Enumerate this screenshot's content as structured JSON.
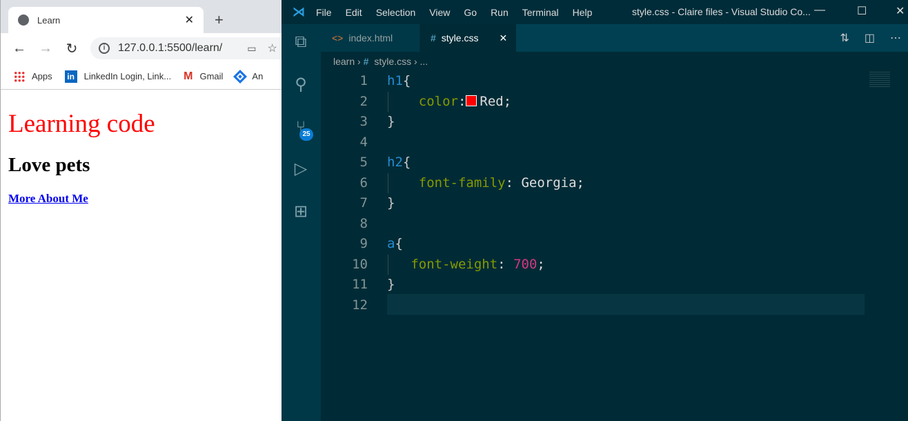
{
  "browser": {
    "tab_title": "Learn",
    "url": "127.0.0.1:5500/learn/",
    "bookmarks": [
      "Apps",
      "LinkedIn Login, Link...",
      "Gmail",
      "An"
    ],
    "page": {
      "h1": "Learning code",
      "h2": "Love pets",
      "link": "More About Me"
    }
  },
  "vscode": {
    "menu": [
      "File",
      "Edit",
      "Selection",
      "View",
      "Go",
      "Run",
      "Terminal",
      "Help"
    ],
    "window_title": "style.css - Claire files - Visual Studio Co...",
    "tabs": [
      {
        "label": "index.html"
      },
      {
        "label": "style.css"
      }
    ],
    "breadcrumb": {
      "folder": "learn",
      "file": "style.css",
      "more": "..."
    },
    "scm_badge": "25",
    "swatch_color": "#ff0000",
    "lines": [
      {
        "n": "1",
        "tokens": [
          [
            "sel",
            "h1"
          ],
          [
            "brace",
            "{"
          ]
        ]
      },
      {
        "n": "2",
        "indent": "    ",
        "tokens": [
          [
            "prop",
            "color"
          ],
          [
            "val",
            ":"
          ],
          [
            "swatch",
            ""
          ],
          [
            "val",
            "Red;"
          ]
        ]
      },
      {
        "n": "3",
        "tokens": [
          [
            "brace",
            "}"
          ]
        ]
      },
      {
        "n": "4",
        "tokens": []
      },
      {
        "n": "5",
        "tokens": [
          [
            "sel",
            "h2"
          ],
          [
            "brace",
            "{"
          ]
        ]
      },
      {
        "n": "6",
        "indent": "    ",
        "tokens": [
          [
            "prop",
            "font-family"
          ],
          [
            "val",
            ": Georgia;"
          ]
        ]
      },
      {
        "n": "7",
        "tokens": [
          [
            "brace",
            "}"
          ]
        ]
      },
      {
        "n": "8",
        "tokens": []
      },
      {
        "n": "9",
        "tokens": [
          [
            "sel",
            "a"
          ],
          [
            "brace",
            "{"
          ]
        ]
      },
      {
        "n": "10",
        "indent": "   ",
        "tokens": [
          [
            "prop",
            "font-weight"
          ],
          [
            "val",
            ": "
          ],
          [
            "num",
            "700"
          ],
          [
            "val",
            ";"
          ]
        ]
      },
      {
        "n": "11",
        "tokens": [
          [
            "brace",
            "}"
          ]
        ]
      },
      {
        "n": "12",
        "tokens": []
      }
    ]
  }
}
